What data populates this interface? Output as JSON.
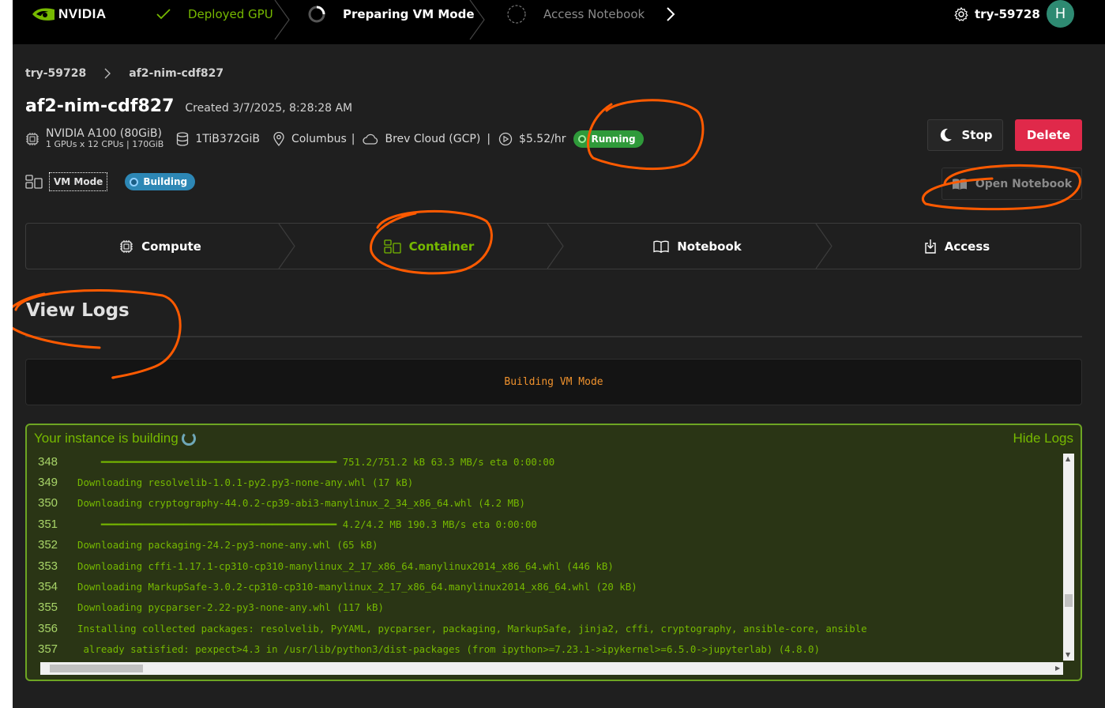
{
  "header": {
    "brand": "NVIDIA",
    "steps": [
      {
        "label": "Deployed GPU",
        "status": "done"
      },
      {
        "label": "Preparing VM Mode",
        "status": "active"
      },
      {
        "label": "Access Notebook",
        "status": "pending"
      }
    ],
    "user": "try-59728",
    "avatar_initial": "H"
  },
  "breadcrumb": [
    "try-59728",
    "af2-nim-cdf827"
  ],
  "instance": {
    "name": "af2-nim-cdf827",
    "created": "Created 3/7/2025, 8:28:28 AM",
    "gpu": "NVIDIA A100 (80GiB)",
    "gpu_sub": "1 GPUs x 12 CPUs | 170GiB",
    "storage": "1TiB372GiB",
    "location": "Columbus",
    "cloud": "Brev Cloud (GCP)",
    "price": "$5.52/hr",
    "status": "Running",
    "mode": "VM Mode",
    "mode_status": "Building"
  },
  "actions": {
    "stop": "Stop",
    "delete": "Delete",
    "open_notebook": "Open Notebook"
  },
  "tabs": [
    {
      "label": "Compute",
      "icon": "chip-icon"
    },
    {
      "label": "Container",
      "icon": "container-icon"
    },
    {
      "label": "Notebook",
      "icon": "book-icon"
    },
    {
      "label": "Access",
      "icon": "download-icon"
    }
  ],
  "logs": {
    "section_title": "View Logs",
    "build_message": "Building VM Mode",
    "header": "Your instance is building",
    "hide_label": "Hide Logs",
    "lines": [
      {
        "n": "348",
        "text": "    ━━━━━━━━━━━━━━━━━━━━━━━━━━━━━━━━━━━━━━━━ 751.2/751.2 kB 63.3 MB/s eta 0:00:00"
      },
      {
        "n": "349",
        "text": "Downloading resolvelib-1.0.1-py2.py3-none-any.whl (17 kB)"
      },
      {
        "n": "350",
        "text": "Downloading cryptography-44.0.2-cp39-abi3-manylinux_2_34_x86_64.whl (4.2 MB)"
      },
      {
        "n": "351",
        "text": "    ━━━━━━━━━━━━━━━━━━━━━━━━━━━━━━━━━━━━━━━━ 4.2/4.2 MB 190.3 MB/s eta 0:00:00"
      },
      {
        "n": "352",
        "text": "Downloading packaging-24.2-py3-none-any.whl (65 kB)"
      },
      {
        "n": "353",
        "text": "Downloading cffi-1.17.1-cp310-cp310-manylinux_2_17_x86_64.manylinux2014_x86_64.whl (446 kB)"
      },
      {
        "n": "354",
        "text": "Downloading MarkupSafe-3.0.2-cp310-cp310-manylinux_2_17_x86_64.manylinux2014_x86_64.whl (20 kB)"
      },
      {
        "n": "355",
        "text": "Downloading pycparser-2.22-py3-none-any.whl (117 kB)"
      },
      {
        "n": "356",
        "text": "Installing collected packages: resolvelib, PyYAML, pycparser, packaging, MarkupSafe, jinja2, cffi, cryptography, ansible-core, ansible"
      },
      {
        "n": "357",
        "text": " already satisfied: pexpect>4.3 in /usr/lib/python3/dist-packages (from ipython>=7.23.1->ipykernel>=6.5.0->jupyterlab) (4.8.0)"
      }
    ]
  },
  "colors": {
    "accent": "#76b900",
    "running": "#2f9a3a",
    "building": "#2d87b5",
    "delete": "#e0294a",
    "annotation": "#ff5a00"
  }
}
